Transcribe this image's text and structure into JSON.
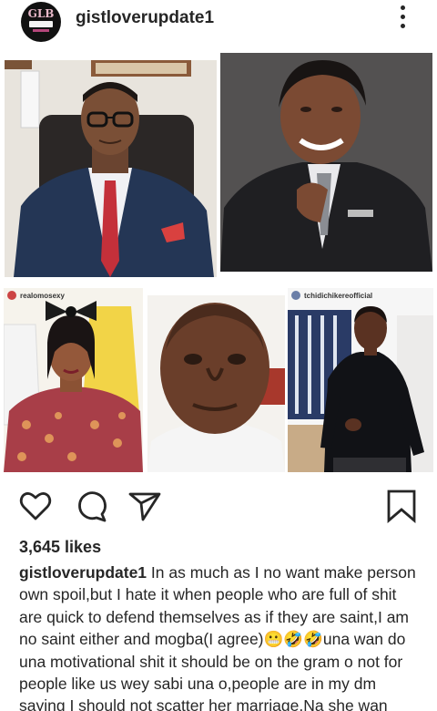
{
  "post": {
    "username": "gistloverupdate1",
    "avatar_logo": "GLB"
  },
  "collage": {
    "tag_left": "realomosexy",
    "tag_right": "tchidichikereofficial"
  },
  "actions": {
    "like_icon": "heart-icon",
    "comment_icon": "comment-icon",
    "share_icon": "send-icon",
    "save_icon": "bookmark-icon"
  },
  "likes": "3,645 likes",
  "caption": {
    "user": "gistloverupdate1",
    "text": " In as much as I no want make person own spoil,but I hate it when people who are full of shit are quick to defend themselves as if they are saint,I am no saint either and mogba(I agree)😬🤣🤣una wan do una motivational shit it should be on the gram o not for people like us wey sabi una o,people are in my dm saying I should not scatter her marriage,Na she wan scatter her Marriage"
  }
}
